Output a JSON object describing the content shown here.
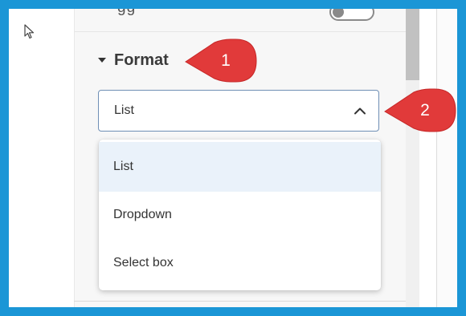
{
  "partial_toggle_label": "gg",
  "section": {
    "title": "Format"
  },
  "format_select": {
    "value": "List"
  },
  "dropdown": {
    "options": [
      {
        "label": "List",
        "selected": true
      },
      {
        "label": "Dropdown",
        "selected": false
      },
      {
        "label": "Select box",
        "selected": false
      }
    ]
  },
  "callouts": [
    {
      "number": "1"
    },
    {
      "number": "2"
    }
  ],
  "colors": {
    "frame_border": "#1b96d6",
    "callout_fill": "#e13a3a",
    "selected_option_bg": "#eaf2fa",
    "select_border": "#6f8fb5"
  },
  "icons": {
    "cursor": "arrow-pointer-icon",
    "section_toggle": "caret-down-icon",
    "select_toggle": "chevron-up-icon"
  }
}
